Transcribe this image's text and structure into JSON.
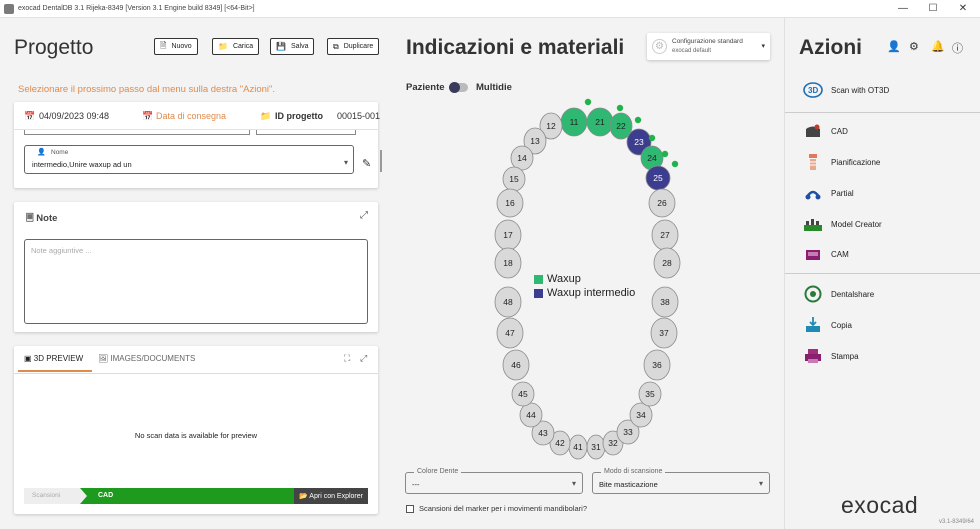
{
  "window": {
    "title": "exocad DentalDB 3.1 Rijeka-8349 [Version 3.1 Engine build 8349] [<64-Bit>]",
    "minimize": "—",
    "maximize": "☐",
    "close": "✕"
  },
  "progetto": {
    "title": "Progetto",
    "buttons": {
      "nuovo": "Nuovo",
      "carica": "Carica",
      "salva": "Salva",
      "duplicare": "Duplicare"
    },
    "next_step": "Selezionare il prossimo passo dal menu sulla destra \"Azioni\".",
    "date": "04/09/2023 09:48",
    "data_consegna": "Data di consegna",
    "id_label": "ID progetto",
    "id_value": "00015-001",
    "nome_label": "Nome",
    "nome_value": "intermedio,Unire waxup ad un",
    "note_title": "Note",
    "note_placeholder": "Note aggiuntive ...",
    "tabs": {
      "preview": "3D PREVIEW",
      "images": "IMAGES/DOCUMENTS"
    },
    "no_scan": "No scan data is available for preview",
    "progress": {
      "scan": "Scansioni",
      "cad": "CAD",
      "open": "Apri con Explorer"
    }
  },
  "indicazioni": {
    "title": "Indicazioni e materiali",
    "config_title": "Configurazione standard",
    "config_sub": "exocad default",
    "toggle_left": "Paziente",
    "toggle_right": "Multidie",
    "legend": [
      {
        "label": "Waxup",
        "color": "#2eb872"
      },
      {
        "label": "Waxup intermedio",
        "color": "#3d3d8f"
      }
    ],
    "teeth_upper": [
      "11",
      "12",
      "13",
      "14",
      "15",
      "16",
      "17",
      "18",
      "21",
      "22",
      "23",
      "24",
      "25",
      "26",
      "27",
      "28"
    ],
    "teeth_lower": [
      "31",
      "32",
      "33",
      "34",
      "35",
      "36",
      "37",
      "38",
      "41",
      "42",
      "43",
      "44",
      "45",
      "46",
      "47",
      "48"
    ],
    "waxup_teeth": [
      "11",
      "21",
      "22",
      "24"
    ],
    "intermedio_teeth": [
      "23",
      "25"
    ],
    "colore_dente_label": "Colore Dente",
    "colore_dente_value": "---",
    "modo_label": "Modo di scansione",
    "modo_value": "Bite masticazione",
    "checkbox_label": "Scansioni del  marker per i movimenti mandibolari?"
  },
  "azioni": {
    "title": "Azioni",
    "actions": [
      {
        "label": "Scan with OT3D",
        "icon": "ot3d-icon"
      },
      {
        "label": "CAD",
        "icon": "cad-icon"
      },
      {
        "label": "Pianificazione",
        "icon": "implant-icon"
      },
      {
        "label": "Partial",
        "icon": "partial-icon"
      },
      {
        "label": "Model Creator",
        "icon": "model-creator-icon"
      },
      {
        "label": "CAM",
        "icon": "cam-icon"
      },
      {
        "label": "Dentalshare",
        "icon": "dentalshare-icon"
      },
      {
        "label": "Copia",
        "icon": "copy-icon"
      },
      {
        "label": "Stampa",
        "icon": "print-icon"
      }
    ],
    "brand": "exocad",
    "version": "v3.1-8349/64"
  },
  "colors": {
    "accent": "#e08a4c",
    "waxup": "#2eb872",
    "intermedio": "#3d3d8f",
    "progress": "#1e9a1e"
  }
}
